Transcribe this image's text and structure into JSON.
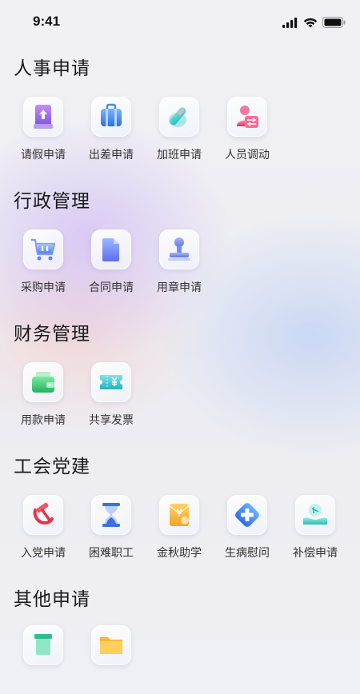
{
  "status_bar": {
    "time": "9:41",
    "icons": [
      "signal-icon",
      "wifi-icon",
      "battery-icon"
    ]
  },
  "sections": [
    {
      "title": "人事申请",
      "items": [
        {
          "label": "请假申请",
          "icon": "leave-request-icon"
        },
        {
          "label": "出差申请",
          "icon": "business-trip-icon"
        },
        {
          "label": "加班申请",
          "icon": "overtime-icon"
        },
        {
          "label": "人员调动",
          "icon": "personnel-transfer-icon"
        }
      ]
    },
    {
      "title": "行政管理",
      "items": [
        {
          "label": "采购申请",
          "icon": "shopping-cart-icon"
        },
        {
          "label": "合同申请",
          "icon": "contract-icon"
        },
        {
          "label": "用章申请",
          "icon": "seal-stamp-icon"
        }
      ]
    },
    {
      "title": "财务管理",
      "items": [
        {
          "label": "用款申请",
          "icon": "wallet-icon"
        },
        {
          "label": "共享发票",
          "icon": "invoice-ticket-icon"
        }
      ]
    },
    {
      "title": "工会党建",
      "items": [
        {
          "label": "入党申请",
          "icon": "party-emblem-icon"
        },
        {
          "label": "困难职工",
          "icon": "hourglass-icon"
        },
        {
          "label": "金秋助学",
          "icon": "scholarship-envelope-icon"
        },
        {
          "label": "生病慰问",
          "icon": "medical-cross-icon"
        },
        {
          "label": "补偿申请",
          "icon": "compensation-hand-icon"
        }
      ]
    },
    {
      "title": "其他申请",
      "items": [
        {
          "label": "",
          "icon": "document-icon"
        },
        {
          "label": "",
          "icon": "folder-icon"
        }
      ]
    }
  ]
}
